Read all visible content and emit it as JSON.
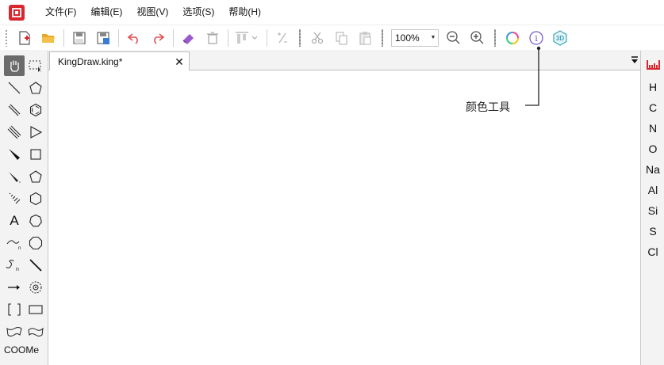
{
  "app": {
    "menu": [
      "文件(F)",
      "编辑(E)",
      "视图(V)",
      "选项(S)",
      "帮助(H)"
    ]
  },
  "toolbar": {
    "zoom_value": "100%",
    "three_d_label": "3D",
    "info_label": "i"
  },
  "document": {
    "tab_title": "KingDraw.king*",
    "close_glyph": "✕"
  },
  "callout": {
    "label": "颜色工具"
  },
  "left_palette": {
    "text_tool": "A",
    "coome_label": "COOMe"
  },
  "elements": [
    "H",
    "C",
    "N",
    "O",
    "Na",
    "Al",
    "Si",
    "S",
    "Cl"
  ],
  "colors": {
    "brand_red": "#d8272e",
    "accent_blue": "#3a7bd5",
    "undo_red": "#e05050",
    "eraser_purple": "#9b59d0",
    "info_purple": "#7a5cc8",
    "three_d_teal": "#3aa6b9",
    "active_tool_bg": "#6b6b6b"
  }
}
